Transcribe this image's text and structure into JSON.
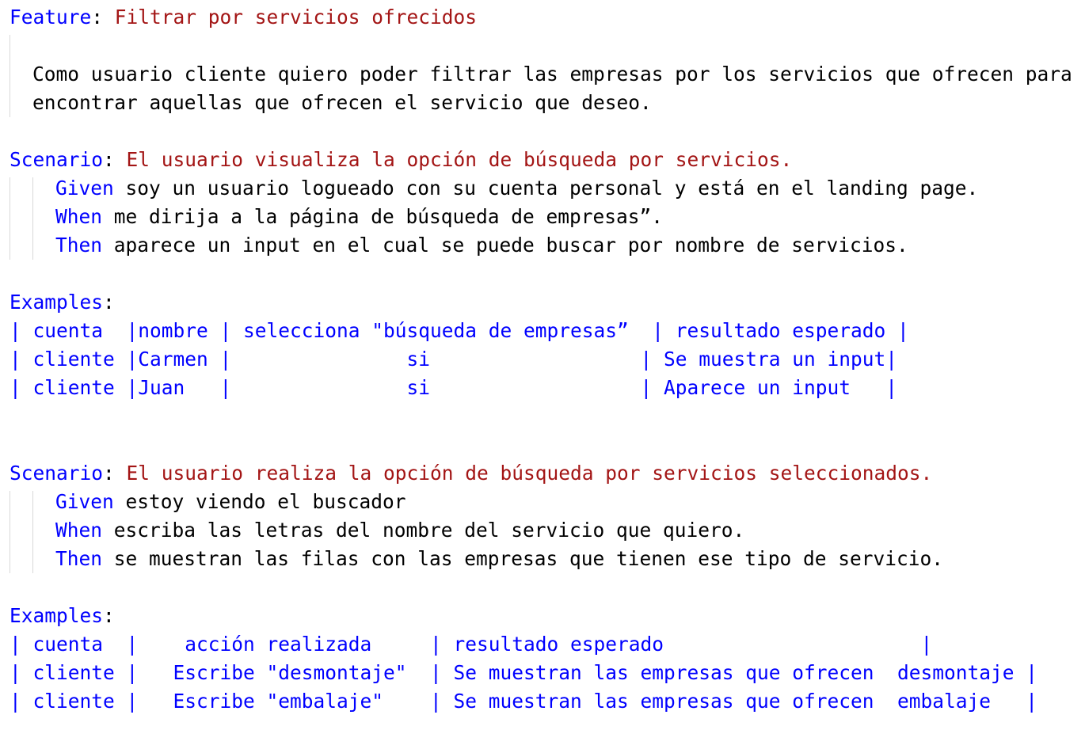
{
  "feature": {
    "keyword": "Feature",
    "title": "Filtrar por servicios ofrecidos",
    "description": [
      "Como usuario cliente quiero poder filtrar las empresas por los servicios que ofrecen para",
      "encontrar aquellas que ofrecen el servicio que deseo."
    ]
  },
  "scenarios": [
    {
      "keyword": "Scenario",
      "title": "El usuario visualiza la opción de búsqueda por servicios.",
      "steps": [
        {
          "keyword": "Given",
          "text": " soy un usuario logueado con su cuenta personal y está en el landing page."
        },
        {
          "keyword": "When",
          "text": " me dirija a la página de búsqueda de empresas”."
        },
        {
          "keyword": "Then",
          "text": " aparece un input en el cual se puede buscar por nombre de servicios."
        }
      ],
      "examples_keyword": "Examples",
      "examples_rows": [
        "| cuenta  |nombre | selecciona \"búsqueda de empresas”  | resultado esperado |",
        "| cliente |Carmen |               si                  | Se muestra un input|",
        "| cliente |Juan   |               si                  | Aparece un input   |"
      ]
    },
    {
      "keyword": "Scenario",
      "title": "El usuario realiza la opción de búsqueda por servicios seleccionados.",
      "steps": [
        {
          "keyword": "Given",
          "text": " estoy viendo el buscador"
        },
        {
          "keyword": "When",
          "text": " escriba las letras del nombre del servicio que quiero."
        },
        {
          "keyword": "Then",
          "text": " se muestran las filas con las empresas que tienen ese tipo de servicio."
        }
      ],
      "examples_keyword": "Examples",
      "examples_rows": [
        "| cuenta  |    acción realizada     | resultado esperado                      |",
        "| cliente |   Escribe \"desmontaje\"  | Se muestran las empresas que ofrecen  desmontaje |",
        "| cliente |   Escribe \"embalaje\"    | Se muestran las empresas que ofrecen  embalaje   |"
      ]
    }
  ]
}
